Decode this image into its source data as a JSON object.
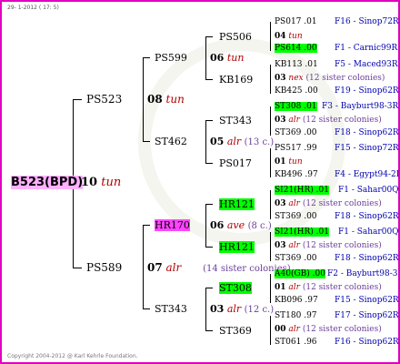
{
  "header": {
    "date": "29-  1-2012 ( 17:  5)"
  },
  "footer": {
    "copyright": "Copyright 2004-2012 @ Karl Kehrle Foundation."
  },
  "root": {
    "id": "B523(BPD)",
    "year": "10",
    "type": "tun"
  },
  "gen2": [
    {
      "id": "PS523",
      "year": "08",
      "type": "tun"
    },
    {
      "id": "PS589",
      "year": "07",
      "type": "alr",
      "note": "(14 sister colonies)"
    }
  ],
  "gen3": [
    {
      "id": "PS599",
      "year": "06",
      "type": "tun"
    },
    {
      "id": "ST462",
      "year": "05",
      "type": "alr",
      "note": "(13 c.)"
    },
    {
      "id": "HR170",
      "year": "06",
      "type": "ave",
      "note": "(8 c.)"
    },
    {
      "id": "ST343",
      "year": "03",
      "type": "alr",
      "note": "(12 c.)"
    }
  ],
  "gen4": [
    "PS506",
    "KB169",
    "ST343",
    "PS017",
    "HR121",
    "HR121",
    "ST308",
    "ST369"
  ],
  "gen5": [
    {
      "line1": "PS017 .01",
      "line1_right": "F16 - Sinop72R",
      "year": "04",
      "type": "tun",
      "line2": "PS614 .00",
      "line2_right": "F1 - Carnic99R"
    },
    {
      "line1": "KB113 .01",
      "line1_right": "F5 - Maced93R",
      "year": "03",
      "type": "nex",
      "note": "(12 sister colonies)",
      "line2": "KB425 .00",
      "line2_right": "F19 - Sinop62R"
    },
    {
      "line1": "ST308 .01",
      "line1_right": "F3 - Bayburt98-3R",
      "year": "03",
      "type": "alr",
      "note": "(12 sister colonies)",
      "line2": "ST369 .00",
      "line2_right": "F18 - Sinop62R"
    },
    {
      "line1": "PS517 .99",
      "line1_right": "F15 - Sinop72R",
      "year": "01",
      "type": "tun",
      "line2": "KB496 .97",
      "line2_right": "F4 - Egypt94-2R"
    },
    {
      "line1": "SI21(HR) .01",
      "line1_right": "F1 - Sahar00Q",
      "year": "03",
      "type": "alr",
      "note": "(12 sister colonies)",
      "line2": "ST369 .00",
      "line2_right": "F18 - Sinop62R"
    },
    {
      "line1": "SI21(HR) .01",
      "line1_right": "F1 - Sahar00Q",
      "year": "03",
      "type": "alr",
      "note": "(12 sister colonies)",
      "line2": "ST369 .00",
      "line2_right": "F18 - Sinop62R"
    },
    {
      "line1": "A40(GB) .00",
      "line1_right": "F2 - Bayburt98-3R",
      "year": "01",
      "type": "alr",
      "note": "(12 sister colonies)",
      "line2": "KB096 .97",
      "line2_right": "F15 - Sinop62R"
    },
    {
      "line1": "ST180 .97",
      "line1_right": "F17 - Sinop62R",
      "year": "00",
      "type": "alr",
      "note": "(12 sister colonies)",
      "line2": "ST061 .96",
      "line2_right": "F16 - Sinop62R"
    }
  ]
}
